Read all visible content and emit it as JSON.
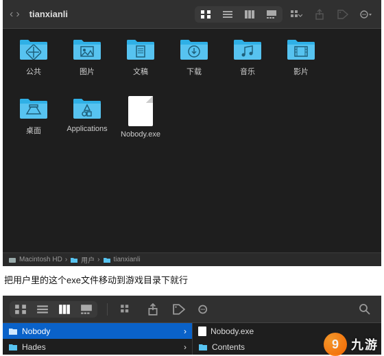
{
  "window1": {
    "title": "tianxianli",
    "items": [
      {
        "label": "公共",
        "icon": "public"
      },
      {
        "label": "图片",
        "icon": "pictures"
      },
      {
        "label": "文稿",
        "icon": "documents"
      },
      {
        "label": "下载",
        "icon": "downloads"
      },
      {
        "label": "音乐",
        "icon": "music"
      },
      {
        "label": "影片",
        "icon": "movies"
      },
      {
        "label": "桌面",
        "icon": "desktop"
      },
      {
        "label": "Applications",
        "icon": "apps"
      },
      {
        "label": "Nobody.exe",
        "icon": "file"
      }
    ],
    "path": [
      {
        "label": "Macintosh HD",
        "icon": "disk"
      },
      {
        "label": "用户",
        "icon": "folder"
      },
      {
        "label": "tianxianli",
        "icon": "folder"
      }
    ]
  },
  "caption": "把用户里的这个exe文件移动到游戏目录下就行",
  "window2": {
    "colsLeft": [
      {
        "label": "Nobody",
        "selected": true,
        "hasChildren": true
      },
      {
        "label": "Hades",
        "selected": false,
        "hasChildren": true
      }
    ],
    "colsRight": [
      {
        "label": "Nobody.exe",
        "type": "file"
      },
      {
        "label": "Contents",
        "type": "folder",
        "hasChildren": true
      }
    ]
  },
  "watermark": {
    "brand": "九游"
  },
  "colors": {
    "folder": "#57c3f0",
    "folderTab": "#2fb0e6",
    "selection": "#0a62c9"
  }
}
